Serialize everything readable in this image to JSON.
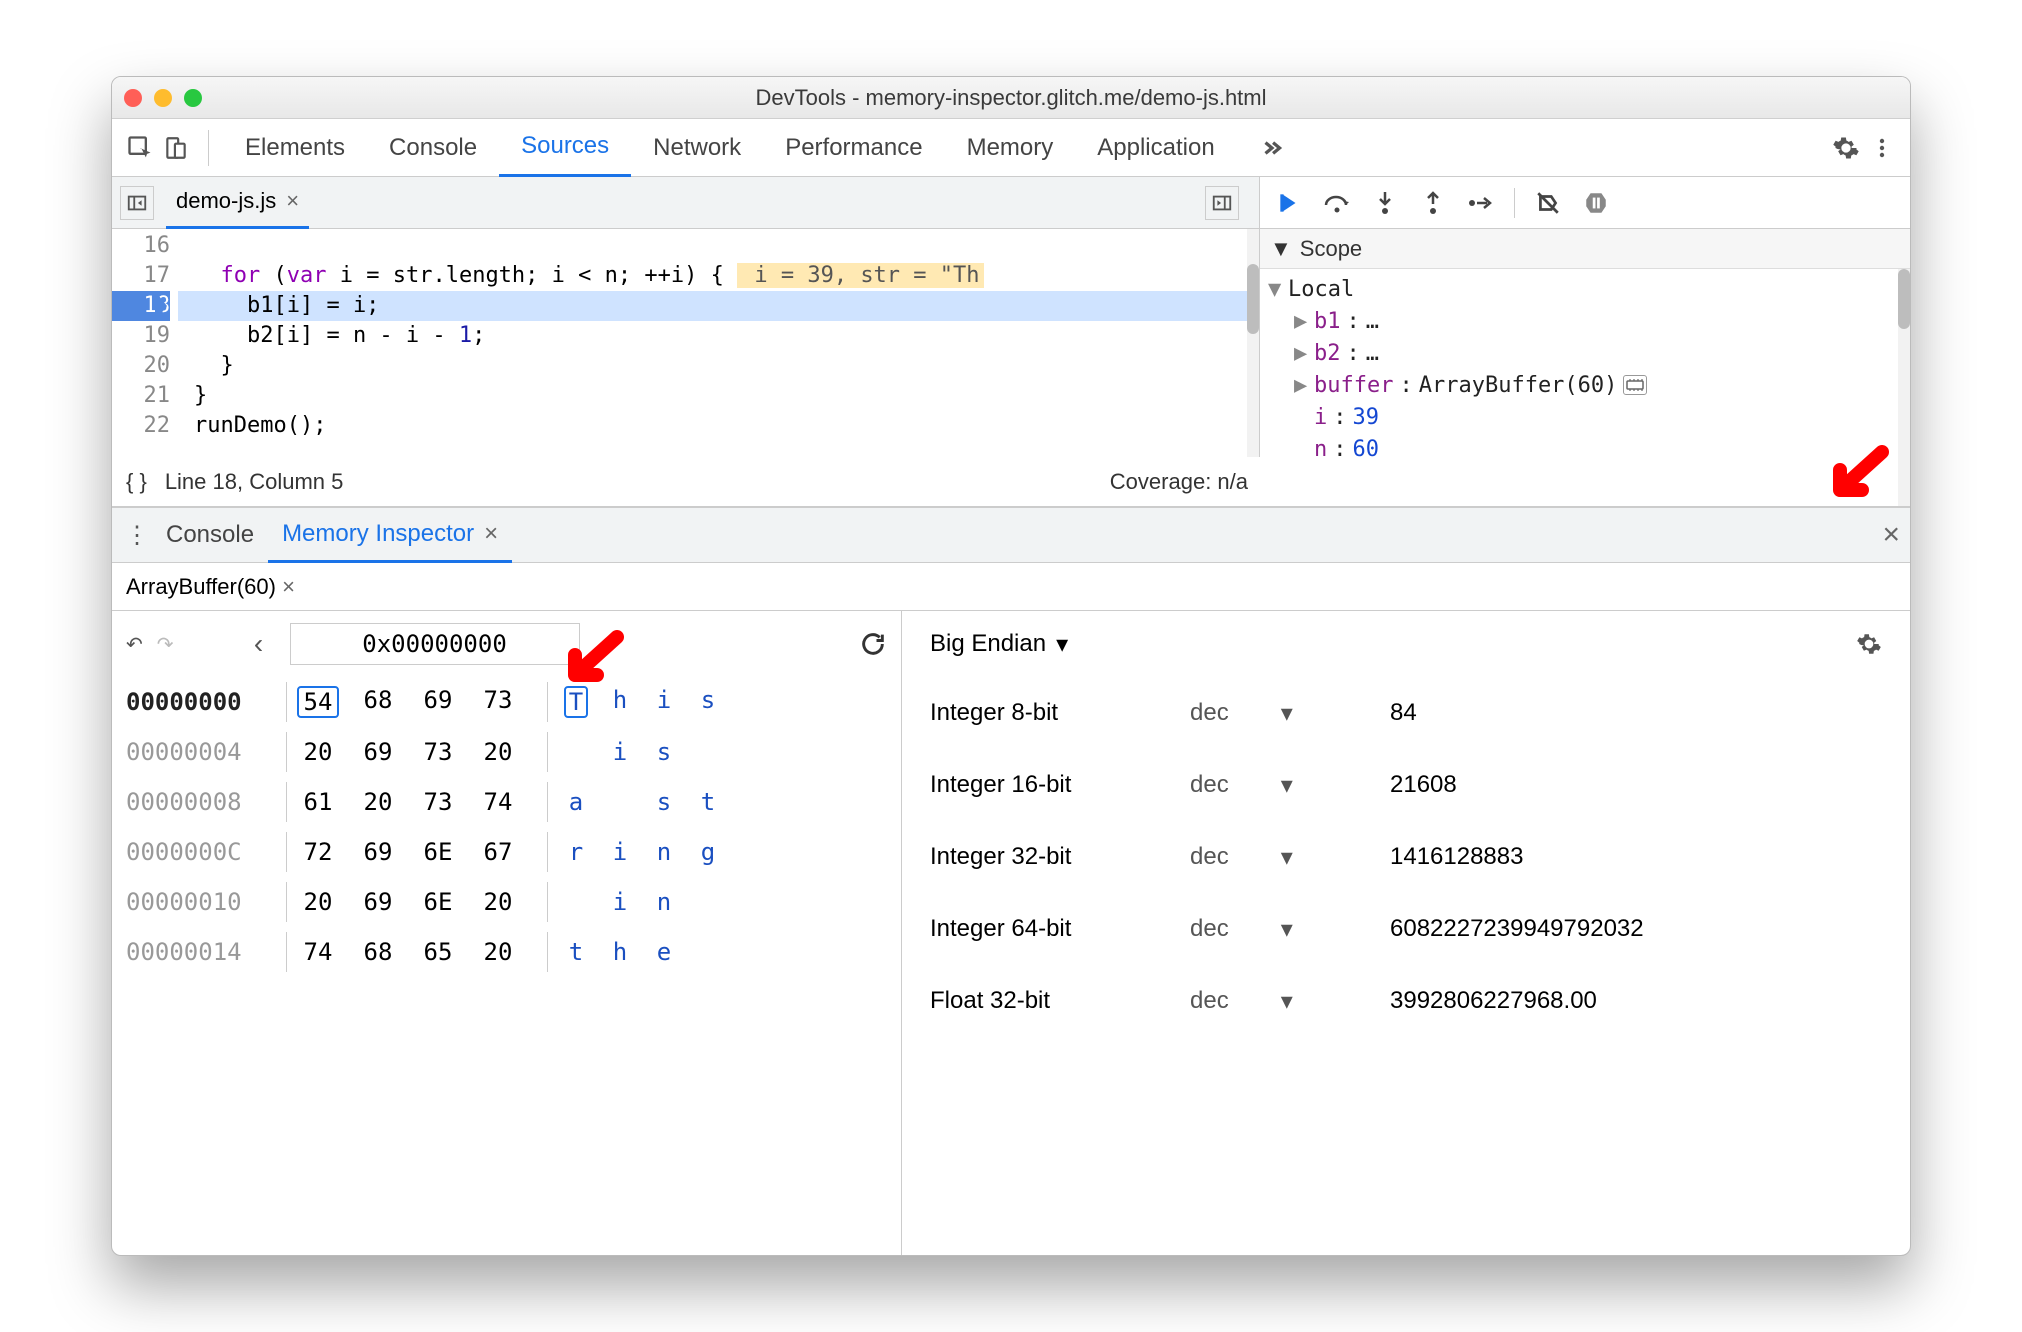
{
  "window": {
    "title": "DevTools - memory-inspector.glitch.me/demo-js.html"
  },
  "tabs": [
    "Elements",
    "Console",
    "Sources",
    "Network",
    "Performance",
    "Memory",
    "Application"
  ],
  "active_tab": "Sources",
  "source_tab": "demo-js.js",
  "code": {
    "lines": [
      {
        "n": 16,
        "text": ""
      },
      {
        "n": 17,
        "text": "  for (var i = str.length; i < n; ++i) {",
        "hint": " i = 39, str = \"Th"
      },
      {
        "n": 18,
        "text": "    b1[i] = i;",
        "exec": true
      },
      {
        "n": 19,
        "text": "    b2[i] = n - i - 1;"
      },
      {
        "n": 20,
        "text": "  }"
      },
      {
        "n": 21,
        "text": "}"
      },
      {
        "n": 22,
        "text": "runDemo();"
      }
    ]
  },
  "status": {
    "format_icon": "{ }",
    "pos": "Line 18, Column 5",
    "coverage": "Coverage: n/a"
  },
  "scope": {
    "title": "Scope",
    "local_label": "Local",
    "items": [
      {
        "name": "b1",
        "value": "…",
        "expandable": true
      },
      {
        "name": "b2",
        "value": "…",
        "expandable": true
      },
      {
        "name": "buffer",
        "value": "ArrayBuffer(60)",
        "expandable": true,
        "mem_icon": true
      },
      {
        "name": "i",
        "value": "39",
        "num": true
      },
      {
        "name": "n",
        "value": "60",
        "num": true
      }
    ]
  },
  "drawer": {
    "tabs": [
      "Console",
      "Memory Inspector"
    ],
    "active": "Memory Inspector",
    "subtab": "ArrayBuffer(60)"
  },
  "hex": {
    "address_input": "0x00000000",
    "rows": [
      {
        "addr": "00000000",
        "bold": true,
        "bytes": [
          "54",
          "68",
          "69",
          "73"
        ],
        "chars": [
          "T",
          "h",
          "i",
          "s"
        ],
        "sel": 0
      },
      {
        "addr": "00000004",
        "bytes": [
          "20",
          "69",
          "73",
          "20"
        ],
        "chars": [
          " ",
          "i",
          "s",
          " "
        ]
      },
      {
        "addr": "00000008",
        "bytes": [
          "61",
          "20",
          "73",
          "74"
        ],
        "chars": [
          "a",
          " ",
          "s",
          "t"
        ]
      },
      {
        "addr": "0000000C",
        "bytes": [
          "72",
          "69",
          "6E",
          "67"
        ],
        "chars": [
          "r",
          "i",
          "n",
          "g"
        ]
      },
      {
        "addr": "00000010",
        "bytes": [
          "20",
          "69",
          "6E",
          "20"
        ],
        "chars": [
          " ",
          "i",
          "n",
          " "
        ]
      },
      {
        "addr": "00000014",
        "bytes": [
          "74",
          "68",
          "65",
          "20"
        ],
        "chars": [
          "t",
          "h",
          "e",
          " "
        ]
      }
    ]
  },
  "values": {
    "endian": "Big Endian",
    "rows": [
      {
        "label": "Integer 8-bit",
        "fmt": "dec",
        "val": "84"
      },
      {
        "label": "Integer 16-bit",
        "fmt": "dec",
        "val": "21608"
      },
      {
        "label": "Integer 32-bit",
        "fmt": "dec",
        "val": "1416128883"
      },
      {
        "label": "Integer 64-bit",
        "fmt": "dec",
        "val": "6082227239949792032"
      },
      {
        "label": "Float 32-bit",
        "fmt": "dec",
        "val": "3992806227968.00"
      }
    ]
  }
}
